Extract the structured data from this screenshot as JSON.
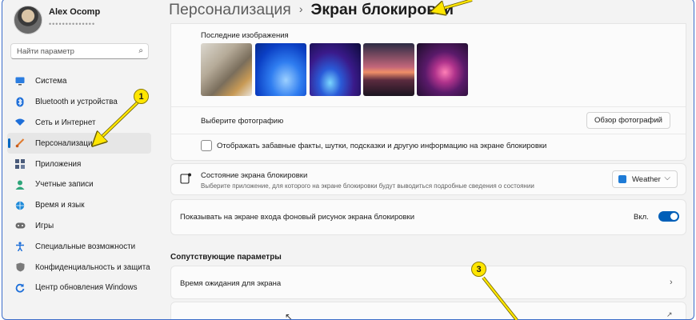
{
  "user": {
    "name": "Alex Ocomp",
    "email": "••••••••••••••"
  },
  "search": {
    "placeholder": "Найти параметр"
  },
  "sidebar": {
    "items": [
      {
        "label": "Система",
        "icon": "monitor-icon"
      },
      {
        "label": "Bluetooth и устройства",
        "icon": "bluetooth-icon"
      },
      {
        "label": "Сеть и Интернет",
        "icon": "wifi-icon"
      },
      {
        "label": "Персонализация",
        "icon": "brush-icon",
        "active": true
      },
      {
        "label": "Приложения",
        "icon": "apps-icon"
      },
      {
        "label": "Учетные записи",
        "icon": "person-icon"
      },
      {
        "label": "Время и язык",
        "icon": "globe-clock-icon"
      },
      {
        "label": "Игры",
        "icon": "gamepad-icon"
      },
      {
        "label": "Специальные возможности",
        "icon": "accessibility-icon"
      },
      {
        "label": "Конфиденциальность и защита",
        "icon": "shield-icon"
      },
      {
        "label": "Центр обновления Windows",
        "icon": "update-icon"
      }
    ]
  },
  "breadcrumb": {
    "parent": "Персонализация",
    "separator": "›",
    "current": "Экран блокировки"
  },
  "recent_images": {
    "label": "Последние изображения"
  },
  "choose_photo": {
    "label": "Выберите фотографию",
    "button": "Обзор фотографий"
  },
  "fun_facts": {
    "label": "Отображать забавные факты, шутки, подсказки и другую информацию на экране блокировки",
    "checked": false
  },
  "lock_status": {
    "title": "Состояние экрана блокировки",
    "description": "Выберите приложение, для которого на экране блокировки будут выводиться подробные сведения о состоянии",
    "selected": "Weather"
  },
  "signin_background": {
    "label": "Показывать на экране входа фоновый рисунок экрана блокировки",
    "state": "Вкл.",
    "on": true
  },
  "related": {
    "title": "Сопутствующие параметры",
    "screen_timeout": "Время ожидания для экрана"
  },
  "annotations": {
    "marker_1": "1",
    "marker_3": "3"
  },
  "colors": {
    "accent": "#005fb8",
    "marker": "#ffe600",
    "window_border": "#3b6cc9"
  }
}
